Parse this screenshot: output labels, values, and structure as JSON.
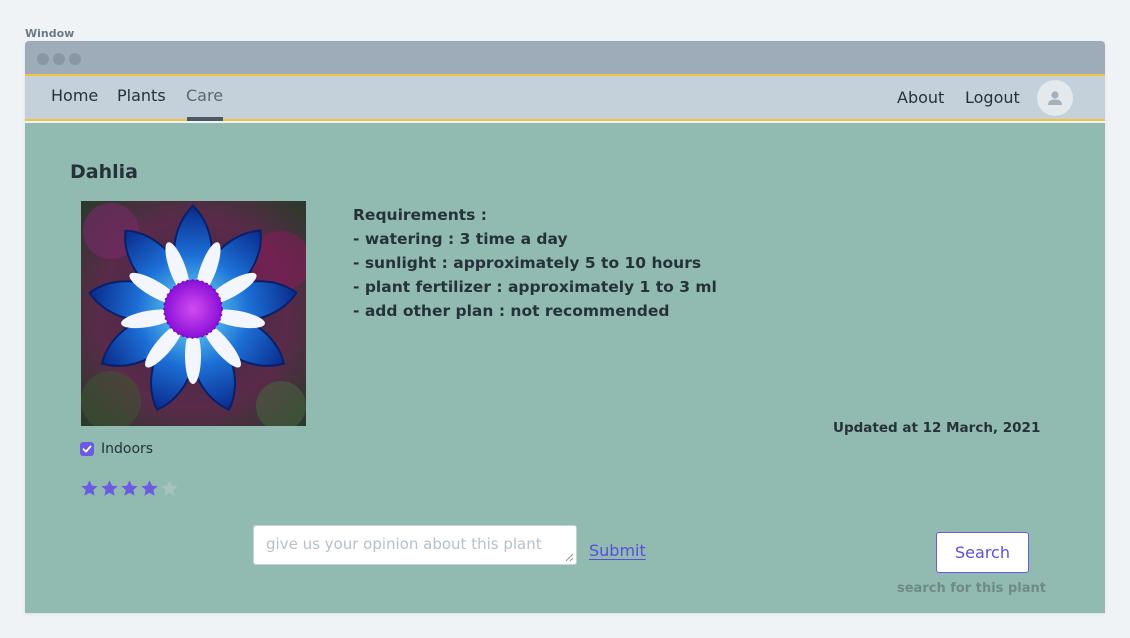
{
  "window": {
    "caption": "Window"
  },
  "nav": {
    "home": "Home",
    "plants": "Plants",
    "care": "Care",
    "about": "About",
    "logout": "Logout"
  },
  "plant": {
    "name": "Dahlia",
    "requirements": [
      "Requirements :",
      "- watering : 3 time a day",
      "- sunlight : approximately 5 to 10 hours",
      "- plant fertilizer : approximately 1 to 3 ml",
      "- add other plan : not recommended"
    ],
    "updated": "Updated at 12 March, 2021",
    "indoors_label": "Indoors",
    "indoors_checked": true,
    "rating": 4,
    "rating_max": 5
  },
  "feedback": {
    "placeholder": "give us your opinion about this plant",
    "submit_label": "Submit"
  },
  "search": {
    "button_label": "Search",
    "hint": "search for this plant"
  },
  "colors": {
    "content_bg": "#91bbb1",
    "accent": "#6a5be2",
    "nav_bg": "#c5d1da",
    "titlebar_bg": "#9eabb8",
    "divider": "#f0c341"
  }
}
